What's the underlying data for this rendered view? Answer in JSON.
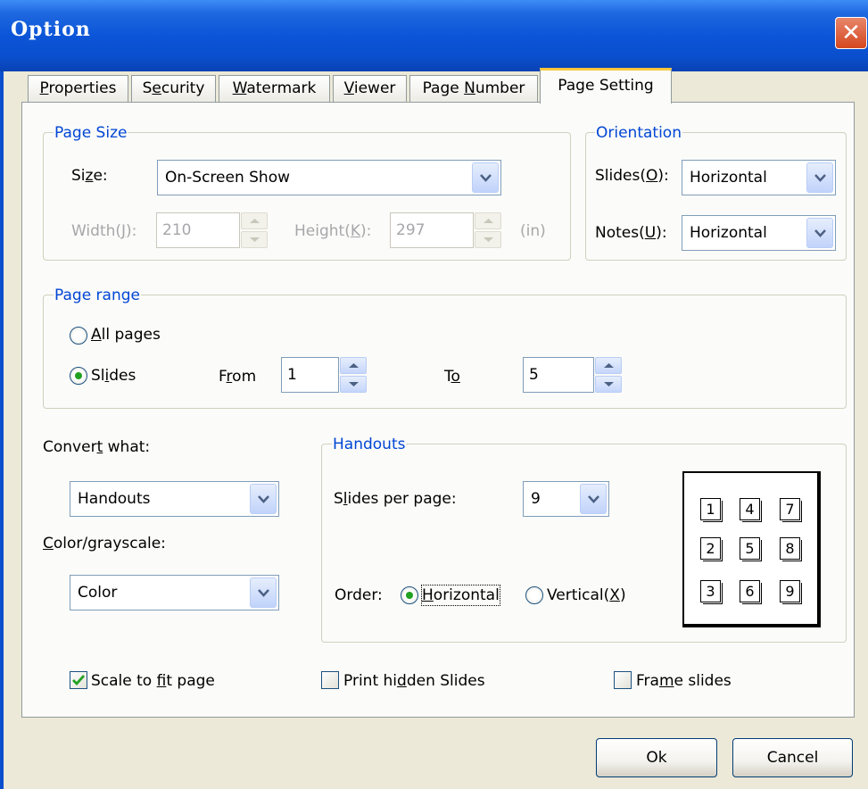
{
  "window": {
    "title": "Option",
    "close_glyph": "✕"
  },
  "tabs": [
    {
      "pre": "",
      "key": "P",
      "post": "roperties"
    },
    {
      "pre": "S",
      "key": "e",
      "post": "curity"
    },
    {
      "pre": "",
      "key": "W",
      "post": "atermark"
    },
    {
      "pre": "",
      "key": "V",
      "post": "iewer"
    },
    {
      "pre": "Page ",
      "key": "N",
      "post": "umber"
    },
    {
      "pre": "Page Setting",
      "key": "",
      "post": ""
    }
  ],
  "active_tab": "Page Setting",
  "page_size": {
    "group_label": "Page Size",
    "size_label_pre": "Si",
    "size_label_key": "z",
    "size_label_post": "e:",
    "size_value": "On-Screen Show",
    "width_label_pre": "Width(",
    "width_label_key": "J",
    "width_label_post": "):",
    "width_value": "210",
    "height_label_pre": "Height(",
    "height_label_key": "K",
    "height_label_post": "):",
    "height_value": "297",
    "unit": "(in)"
  },
  "orientation": {
    "group_label": "Orientation",
    "slides_label_pre": "Slides(",
    "slides_label_key": "O",
    "slides_label_post": "):",
    "slides_value": "Horizontal",
    "notes_label_pre": "Notes(",
    "notes_label_key": "U",
    "notes_label_post": "):",
    "notes_value": "Horizontal"
  },
  "page_range": {
    "group_label": "Page range",
    "all_pre": "",
    "all_key": "A",
    "all_post": "ll pages",
    "slides_pre": "Sl",
    "slides_key": "i",
    "slides_post": "des",
    "from_pre": "F",
    "from_key": "r",
    "from_post": "om",
    "from_value": "1",
    "to_pre": "T",
    "to_key": "o",
    "to_post": "",
    "to_value": "5",
    "selected": "Slides"
  },
  "convert": {
    "label_pre": "Conver",
    "label_key": "t",
    "label_post": " what:",
    "value": "Handouts",
    "color_label_pre": "",
    "color_label_key": "C",
    "color_label_post": "olor/grayscale:",
    "color_value": "Color"
  },
  "handouts": {
    "group_label": "Handouts",
    "spp_label_pre": "S",
    "spp_label_key": "l",
    "spp_label_post": "ides per page:",
    "spp_value": "9",
    "order_label": "Order:",
    "horizontal_pre": "",
    "horizontal_key": "H",
    "horizontal_post": "orizontal",
    "vertical_pre": "Vertical(",
    "vertical_key": "X",
    "vertical_post": ")",
    "order_selected": "Horizontal",
    "preview": [
      "1",
      "4",
      "7",
      "2",
      "5",
      "8",
      "3",
      "6",
      "9"
    ]
  },
  "options": {
    "scale_pre": "Scale to ",
    "scale_key": "f",
    "scale_post": "it page",
    "scale_checked": true,
    "hidden_pre": "Print hi",
    "hidden_key": "d",
    "hidden_post": "den Slides",
    "hidden_checked": false,
    "frame_pre": "Fra",
    "frame_key": "m",
    "frame_post": "e slides",
    "frame_checked": false
  },
  "buttons": {
    "ok": "Ok",
    "cancel": "Cancel"
  },
  "colors": {
    "title_bar": "#0a4fcd",
    "group_label": "#0046d5",
    "tab_highlight": "#ffc73c",
    "radio_dot": "#21a121"
  }
}
